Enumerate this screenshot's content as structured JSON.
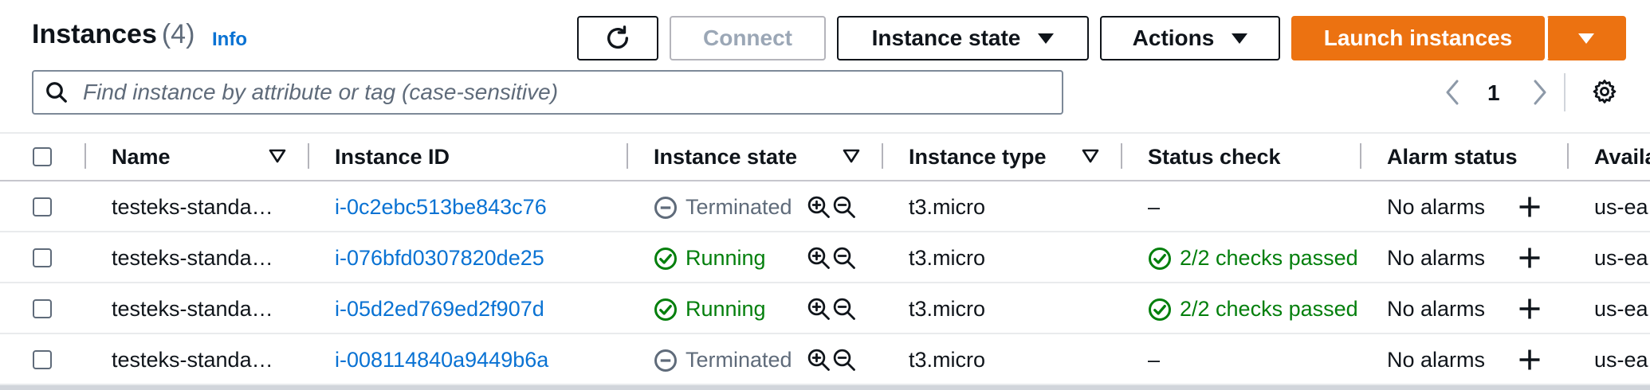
{
  "header": {
    "title": "Instances",
    "count": "(4)",
    "info_label": "Info"
  },
  "toolbar": {
    "connect_label": "Connect",
    "instance_state_label": "Instance state",
    "actions_label": "Actions",
    "launch_label": "Launch instances"
  },
  "search": {
    "placeholder": "Find instance by attribute or tag (case-sensitive)",
    "value": ""
  },
  "pagination": {
    "current_page": "1"
  },
  "table": {
    "columns": [
      "Name",
      "Instance ID",
      "Instance state",
      "Instance type",
      "Status check",
      "Alarm status",
      "Availa"
    ],
    "rows": [
      {
        "name": "testeks-standa…",
        "instance_id": "i-0c2ebc513be843c76",
        "state": "Terminated",
        "type": "t3.micro",
        "status_check": "–",
        "alarm": "No alarms",
        "az": "us-ea"
      },
      {
        "name": "testeks-standa…",
        "instance_id": "i-076bfd0307820de25",
        "state": "Running",
        "type": "t3.micro",
        "status_check": "2/2 checks passed",
        "alarm": "No alarms",
        "az": "us-ea"
      },
      {
        "name": "testeks-standa…",
        "instance_id": "i-05d2ed769ed2f907d",
        "state": "Running",
        "type": "t3.micro",
        "status_check": "2/2 checks passed",
        "alarm": "No alarms",
        "az": "us-ea"
      },
      {
        "name": "testeks-standa…",
        "instance_id": "i-008114840a9449b6a",
        "state": "Terminated",
        "type": "t3.micro",
        "status_check": "–",
        "alarm": "No alarms",
        "az": "us-ea"
      }
    ]
  },
  "colors": {
    "primary": "#ec7211",
    "link": "#0972d3",
    "success": "#037f0c",
    "muted": "#5f6b7a"
  }
}
